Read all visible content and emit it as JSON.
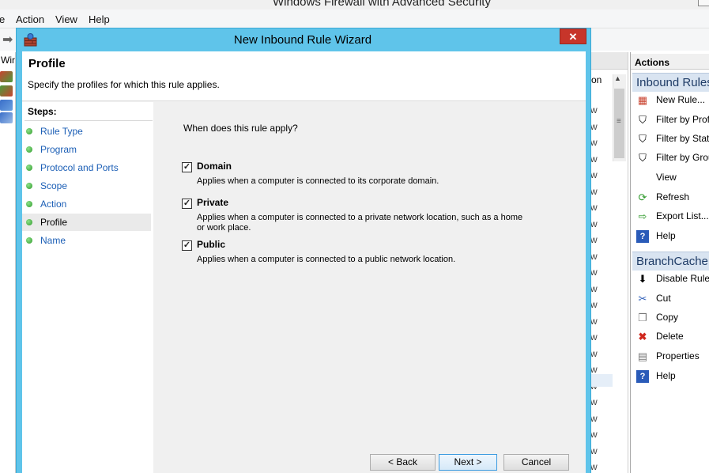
{
  "background_window": {
    "title": "Windows Firewall with Advanced Security",
    "menu": [
      "e",
      "Action",
      "View",
      "Help"
    ],
    "tree_label": "Wir",
    "column_header": "on",
    "row_fragment": "w"
  },
  "actions_pane": {
    "header": "Actions",
    "section1": "Inbound Rules",
    "section1_items": [
      {
        "label": "New Rule...",
        "icon": "new-rule-icon"
      },
      {
        "label": "Filter by Profile",
        "icon": "filter-icon"
      },
      {
        "label": "Filter by State",
        "icon": "filter-icon"
      },
      {
        "label": "Filter by Group",
        "icon": "filter-icon"
      },
      {
        "label": "View",
        "icon": "view-icon"
      },
      {
        "label": "Refresh",
        "icon": "refresh-icon"
      },
      {
        "label": "Export List...",
        "icon": "export-icon"
      },
      {
        "label": "Help",
        "icon": "help-icon"
      }
    ],
    "section2": "BranchCache Content Retrieval",
    "section2_items": [
      {
        "label": "Disable Rule",
        "icon": "disable-icon"
      },
      {
        "label": "Cut",
        "icon": "cut-icon"
      },
      {
        "label": "Copy",
        "icon": "copy-icon"
      },
      {
        "label": "Delete",
        "icon": "delete-icon"
      },
      {
        "label": "Properties",
        "icon": "properties-icon"
      },
      {
        "label": "Help",
        "icon": "help-icon"
      }
    ]
  },
  "dialog": {
    "title": "New Inbound Rule Wizard",
    "close_glyph": "✕",
    "heading": "Profile",
    "subheading": "Specify the profiles for which this rule applies.",
    "steps_title": "Steps:",
    "steps": [
      {
        "label": "Rule Type",
        "current": false
      },
      {
        "label": "Program",
        "current": false
      },
      {
        "label": "Protocol and Ports",
        "current": false
      },
      {
        "label": "Scope",
        "current": false
      },
      {
        "label": "Action",
        "current": false
      },
      {
        "label": "Profile",
        "current": true
      },
      {
        "label": "Name",
        "current": false
      }
    ],
    "question": "When does this rule apply?",
    "options": [
      {
        "label": "Domain",
        "checked": true,
        "description": "Applies when a computer is connected to its corporate domain."
      },
      {
        "label": "Private",
        "checked": true,
        "description": "Applies when a computer is connected to a private network location, such as a home or work place."
      },
      {
        "label": "Public",
        "checked": true,
        "description": "Applies when a computer is connected to a public network location."
      }
    ],
    "buttons": {
      "back": "< Back",
      "next": "Next >",
      "cancel": "Cancel"
    }
  },
  "colors": {
    "dialog_frame": "#5fc4ea",
    "close_button": "#c7352a",
    "step_link": "#1c5fb6",
    "actions_section": "#d9e4f1"
  }
}
